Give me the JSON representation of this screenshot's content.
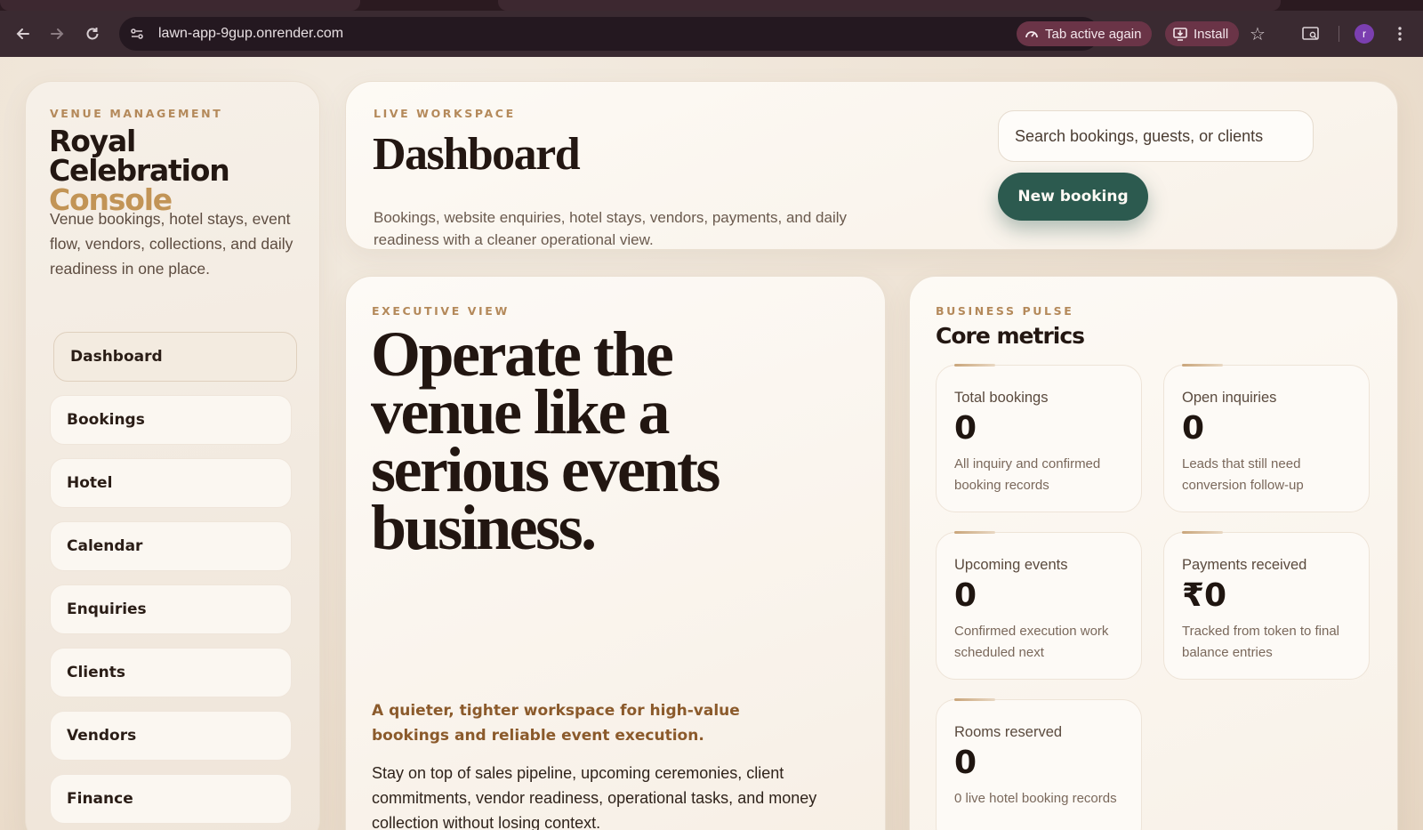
{
  "browser": {
    "url": "lawn-app-9gup.onrender.com",
    "tab_active_chip": "Tab active again",
    "install_chip": "Install",
    "profile_initial": "r"
  },
  "sidebar": {
    "eyebrow": "VENUE MANAGEMENT",
    "title_line1": "Royal Celebration",
    "title_line2": "Console",
    "description": "Venue bookings, hotel stays, event flow, vendors, collections, and daily readiness in one place.",
    "items": [
      {
        "label": "Dashboard",
        "active": true
      },
      {
        "label": "Bookings"
      },
      {
        "label": "Hotel"
      },
      {
        "label": "Calendar"
      },
      {
        "label": "Enquiries"
      },
      {
        "label": "Clients"
      },
      {
        "label": "Vendors"
      },
      {
        "label": "Finance"
      }
    ]
  },
  "header": {
    "eyebrow": "LIVE WORKSPACE",
    "title": "Dashboard",
    "subtitle": "Bookings, website enquiries, hotel stays, vendors, payments, and daily readiness with a cleaner operational view.",
    "search_placeholder": "Search bookings, guests, or clients",
    "new_booking_label": "New booking"
  },
  "executive": {
    "eyebrow": "EXECUTIVE VIEW",
    "headline": "Operate the venue like a serious events business.",
    "tagline": "A quieter, tighter workspace for high-value bookings and reliable event execution.",
    "body": "Stay on top of sales pipeline, upcoming ceremonies, client commitments, vendor readiness, operational tasks, and money collection without losing context."
  },
  "metrics": {
    "eyebrow": "BUSINESS PULSE",
    "title": "Core metrics",
    "items": [
      {
        "label": "Total bookings",
        "value": "0",
        "desc": "All inquiry and confirmed booking records"
      },
      {
        "label": "Open inquiries",
        "value": "0",
        "desc": "Leads that still need conversion follow-up"
      },
      {
        "label": "Upcoming events",
        "value": "0",
        "desc": "Confirmed execution work scheduled next"
      },
      {
        "label": "Payments received",
        "value": "₹0",
        "desc": "Tracked from token to final balance entries"
      },
      {
        "label": "Rooms reserved",
        "value": "0",
        "desc": "0 live hotel booking records"
      }
    ]
  },
  "colors": {
    "accent_gold": "#c29456",
    "primary_button": "#2c5a4f",
    "tagline_brown": "#8b5a2b"
  }
}
